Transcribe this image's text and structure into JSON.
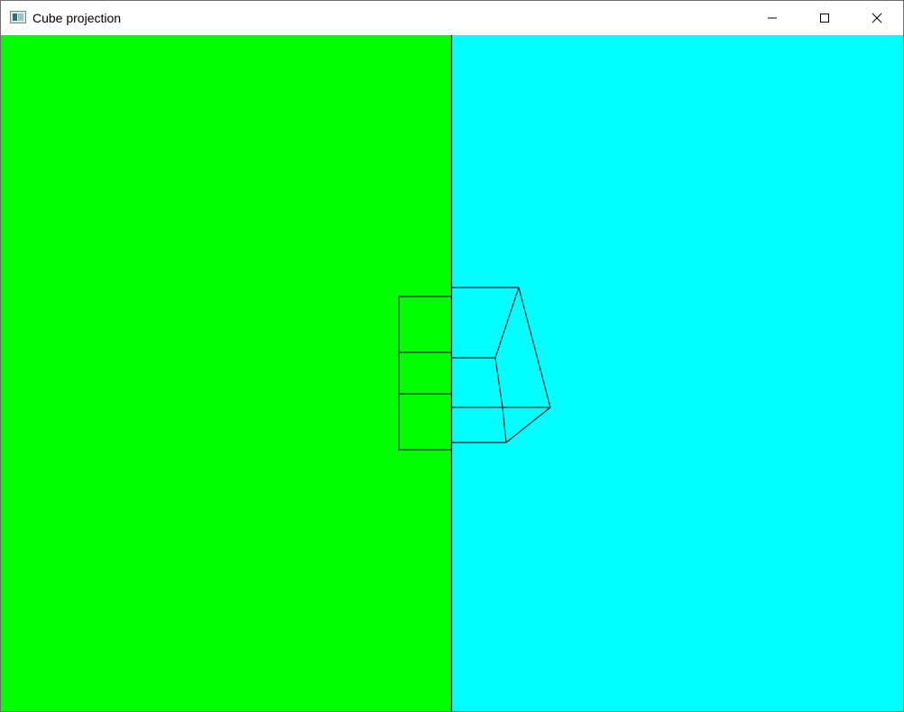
{
  "window": {
    "title": "Cube projection",
    "controls": {
      "minimize_icon": "minimize-icon",
      "maximize_icon": "maximize-icon",
      "close_icon": "close-icon"
    }
  },
  "canvas": {
    "left_view_color": "#00ff00",
    "right_view_color": "#00ffff",
    "line_color": "#1f2a2a",
    "divider_color": "#1a1a1a"
  }
}
